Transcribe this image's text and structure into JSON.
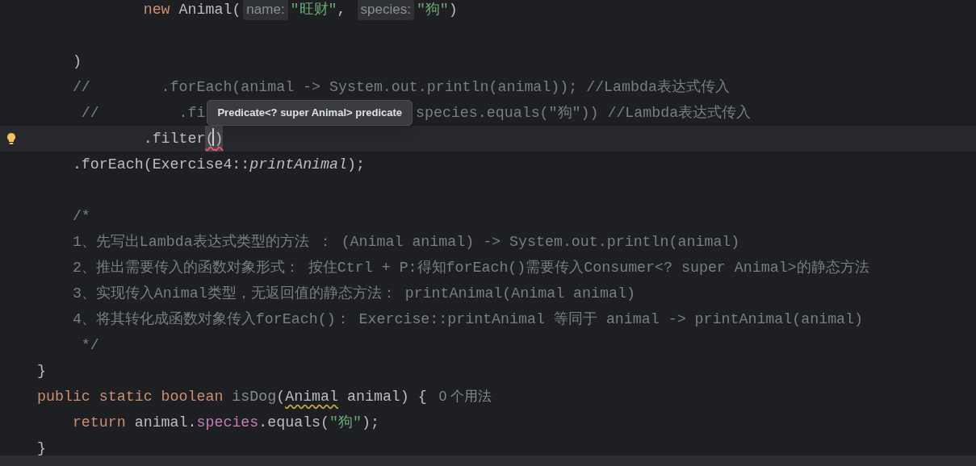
{
  "editor": {
    "lines": [
      {
        "current": false,
        "bulb": false,
        "tokens": [
          {
            "kind": "keyword",
            "text": "            new"
          },
          {
            "kind": "plain",
            "text": " Animal("
          },
          {
            "kind": "hint",
            "text": "name:"
          },
          {
            "kind": "string",
            "text": "\"旺财\""
          },
          {
            "kind": "plain",
            "text": ", "
          },
          {
            "kind": "hint",
            "text": "species:"
          },
          {
            "kind": "string",
            "text": "\"狗\""
          },
          {
            "kind": "plain",
            "text": ")"
          }
        ]
      },
      {
        "current": false,
        "bulb": false
      },
      {
        "current": false,
        "bulb": false,
        "tokens": [
          {
            "kind": "plain",
            "text": "    )"
          }
        ]
      },
      {
        "current": false,
        "bulb": false,
        "tokens": [
          {
            "kind": "comment",
            "text": "    //        .forEach(animal -> System.out.println(animal)); //Lambda表达式传入"
          }
        ]
      },
      {
        "current": false,
        "bulb": false,
        "tokens": [
          {
            "kind": "comment",
            "text": "     //         .fi"
          },
          {
            "kind": "tooltip",
            "text": "Predicate<? super Animal> predicate"
          },
          {
            "kind": "comment",
            "text": "species.equals(\"狗\")) //Lambda表达式传入"
          }
        ]
      },
      {
        "current": true,
        "bulb": true,
        "tokens": [
          {
            "kind": "plain",
            "text": "            .filter"
          },
          {
            "kind": "bracket-caret",
            "text": "("
          },
          {
            "kind": "bracket",
            "text": ")"
          }
        ]
      },
      {
        "current": false,
        "bulb": false,
        "tokens": [
          {
            "kind": "plain",
            "text": "    .forEach(Exercise4::"
          },
          {
            "kind": "italic",
            "text": "printAnimal"
          },
          {
            "kind": "plain",
            "text": ");"
          }
        ]
      },
      {
        "current": false,
        "bulb": false
      },
      {
        "current": false,
        "bulb": false,
        "tokens": [
          {
            "kind": "comment",
            "text": "    /*"
          }
        ]
      },
      {
        "current": false,
        "bulb": false,
        "tokens": [
          {
            "kind": "comment",
            "text": "    1、先写出Lambda表达式类型的方法 ： (Animal animal) -> System.out.println(animal)"
          }
        ]
      },
      {
        "current": false,
        "bulb": false,
        "tokens": [
          {
            "kind": "comment",
            "text": "    2、推出需要传入的函数对象形式： 按住Ctrl + P:得知forEach()需要传入Consumer<? super Animal>的静态方法"
          }
        ]
      },
      {
        "current": false,
        "bulb": false,
        "tokens": [
          {
            "kind": "comment",
            "text": "    3、实现传入Animal类型，无返回值的静态方法： printAnimal(Animal animal)"
          }
        ]
      },
      {
        "current": false,
        "bulb": false,
        "tokens": [
          {
            "kind": "comment",
            "text": "    4、将其转化成函数对象传入forEach()： Exercise::printAnimal 等同于 animal -> printAnimal(animal)"
          }
        ]
      },
      {
        "current": false,
        "bulb": false,
        "tokens": [
          {
            "kind": "comment",
            "text": "     */"
          }
        ]
      },
      {
        "current": false,
        "bulb": false,
        "tokens": [
          {
            "kind": "plain",
            "text": "}"
          }
        ]
      },
      {
        "current": false,
        "bulb": false,
        "tokens": [
          {
            "kind": "keyword",
            "text": "public static boolean "
          },
          {
            "kind": "unused",
            "text": "isDog"
          },
          {
            "kind": "plain",
            "text": "("
          },
          {
            "kind": "warning",
            "text": "Animal"
          },
          {
            "kind": "plain",
            "text": " animal) { "
          },
          {
            "kind": "usages",
            "text": "0 个用法"
          }
        ]
      },
      {
        "current": false,
        "bulb": false,
        "tokens": [
          {
            "kind": "keyword",
            "text": "    return"
          },
          {
            "kind": "plain",
            "text": " animal."
          },
          {
            "kind": "field",
            "text": "species"
          },
          {
            "kind": "plain",
            "text": ".equals("
          },
          {
            "kind": "string",
            "text": "\"狗\""
          },
          {
            "kind": "plain",
            "text": ");"
          }
        ]
      },
      {
        "current": false,
        "bulb": false,
        "tokens": [
          {
            "kind": "plain",
            "text": "}"
          }
        ]
      }
    ]
  }
}
